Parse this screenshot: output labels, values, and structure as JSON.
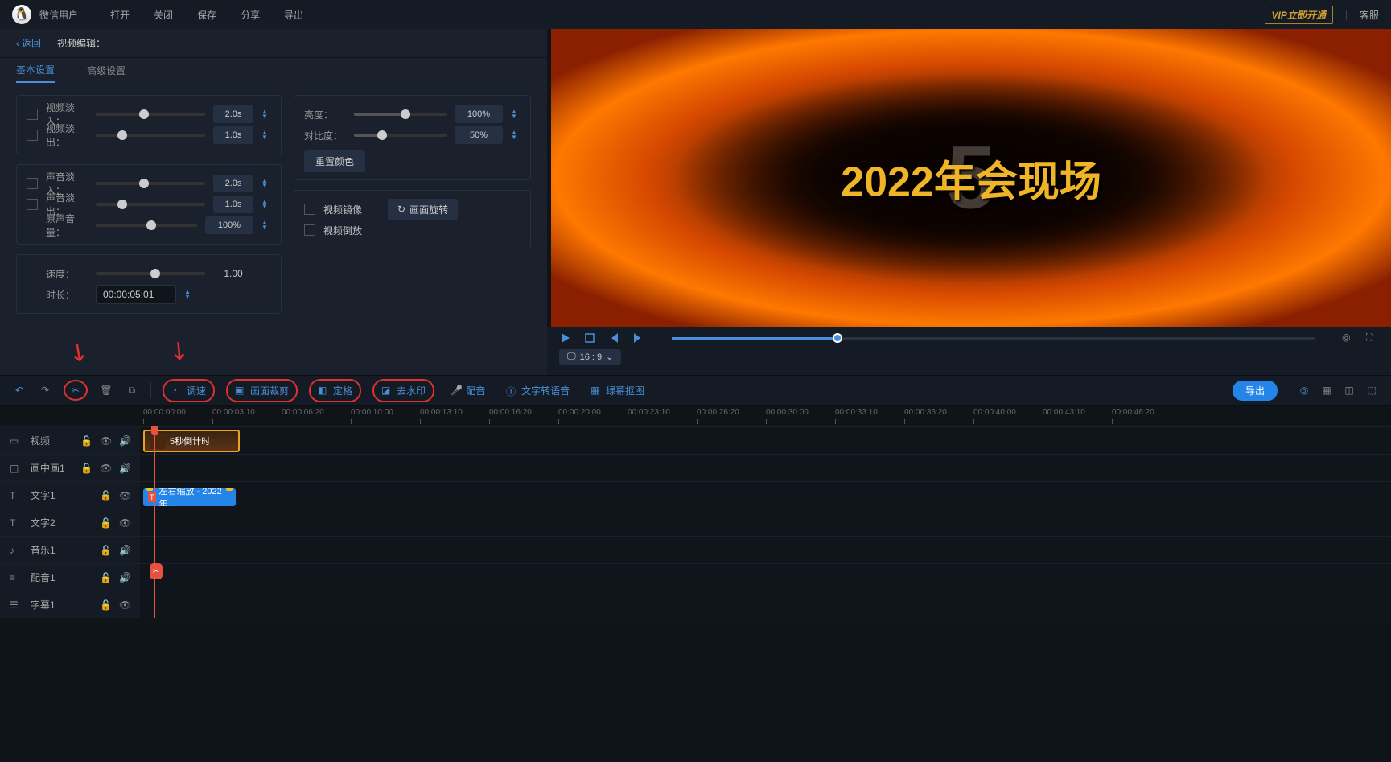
{
  "header": {
    "username": "微信用户",
    "menu": [
      "打开",
      "关闭",
      "保存",
      "分享",
      "导出"
    ],
    "vip": "VIP立即开通",
    "service": "客服"
  },
  "editor": {
    "back": "返回",
    "title": "视频编辑：",
    "tabs": [
      "基本设置",
      "高级设置"
    ]
  },
  "settings": {
    "video_fade_in": "视频淡入：",
    "video_fade_out": "视频淡出：",
    "audio_fade_in": "声音淡入：",
    "audio_fade_out": "声音淡出：",
    "original_volume": "原声音量：",
    "speed": "速度：",
    "duration": "时长：",
    "brightness": "亮度：",
    "contrast": "对比度：",
    "reset_color": "重置颜色",
    "video_mirror": "视频镜像",
    "rotate": "画面旋转",
    "video_reverse": "视频倒放",
    "val_2s": "2.0s",
    "val_1s": "1.0s",
    "val_100": "100%",
    "val_50": "50%",
    "val_speed": "1.00",
    "val_time": "00:00:05:01"
  },
  "preview": {
    "text": "2022年会现场",
    "aspect": "16 : 9"
  },
  "toolbar": {
    "speed": "调速",
    "crop": "画面裁剪",
    "freeze": "定格",
    "watermark": "去水印",
    "dub": "配音",
    "tts": "文字转语音",
    "greenscreen": "绿幕抠图",
    "export": "导出"
  },
  "timeline": {
    "ticks": [
      "00:00:00:00",
      "00:00:03:10",
      "00:00:06:20",
      "00:00:10:00",
      "00:00:13:10",
      "00:00:16:20",
      "00:00:20:00",
      "00:00:23:10",
      "00:00:26:20",
      "00:00:30:00",
      "00:00:33:10",
      "00:00:36:20",
      "00:00:40:00",
      "00:00:43:10",
      "00:00:46:20"
    ],
    "tracks": {
      "video": "视频",
      "pip": "画中画1",
      "text1": "文字1",
      "text2": "文字2",
      "music": "音乐1",
      "dub": "配音1",
      "subtitle": "字幕1"
    },
    "clips": {
      "video_label": "5秒倒计时",
      "text_label": "左右缩放 - 2022年..."
    }
  }
}
